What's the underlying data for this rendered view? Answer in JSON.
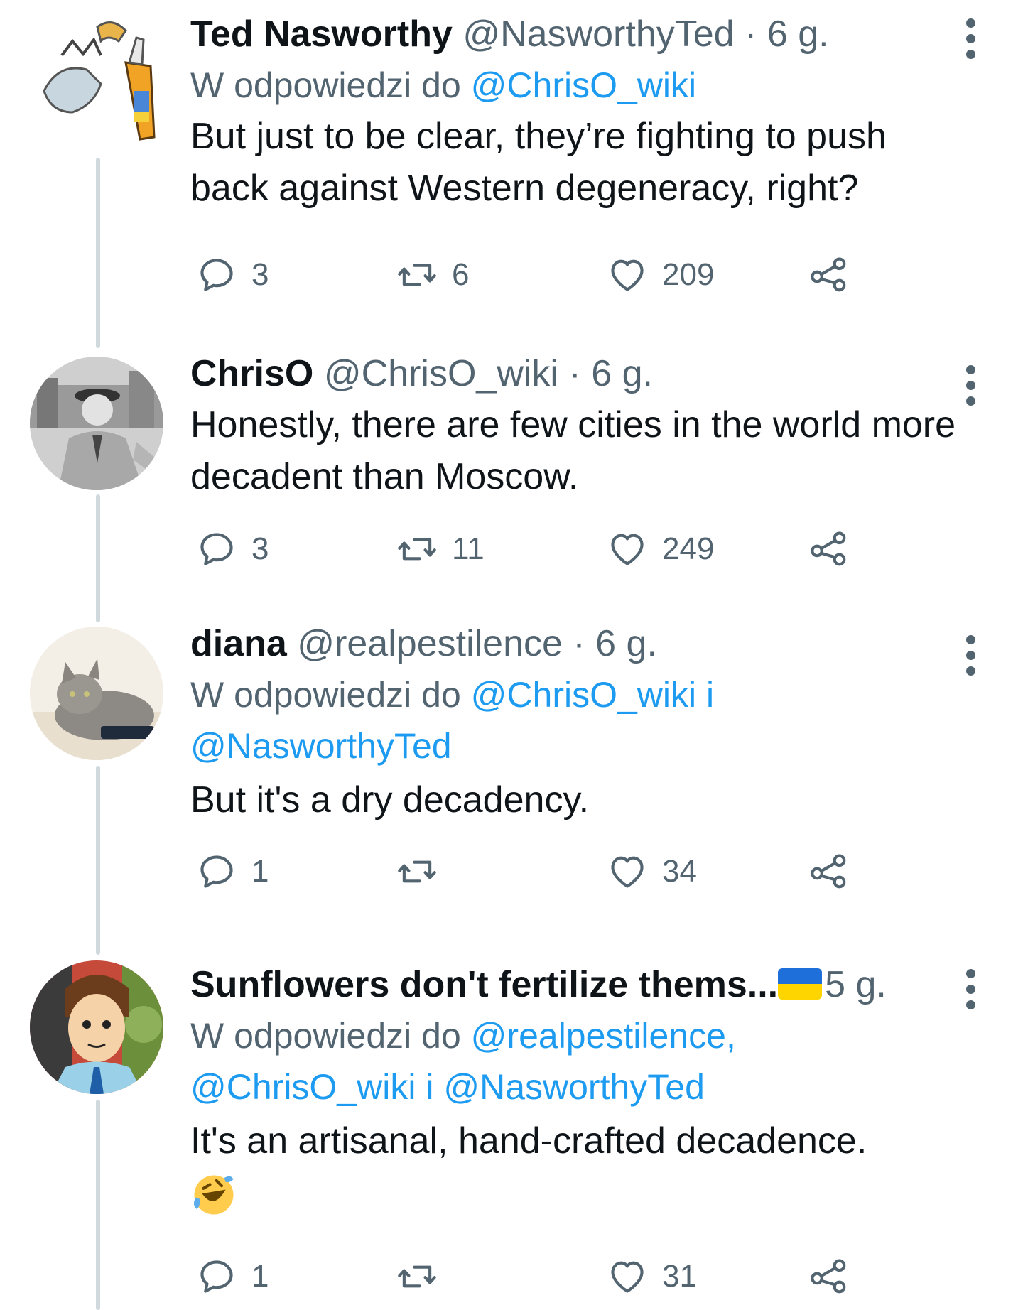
{
  "tweets": [
    {
      "name": "Ted Nasworthy",
      "handle": "@NasworthyTed",
      "sep": "·",
      "time": "6 g.",
      "reply_prefix": "W odpowiedzi do",
      "reply_mentions_line1": "@ChrisO_wiki",
      "reply_mentions_line2": "",
      "text": "But just to be clear, they’re fighting to push back against Western degeneracy, right?",
      "replies": "3",
      "retweets": "6",
      "likes": "209"
    },
    {
      "name": "ChrisO",
      "handle": "@ChrisO_wiki",
      "sep": "·",
      "time": "6 g.",
      "text": "Honestly, there are few cities in the world more decadent than Moscow.",
      "replies": "3",
      "retweets": "11",
      "likes": "249"
    },
    {
      "name": "diana",
      "handle": "@realpestilence",
      "sep": "·",
      "time": "6 g.",
      "reply_prefix": "W odpowiedzi do",
      "reply_mentions_line1": "@ChrisO_wiki i",
      "reply_mentions_line2": "@NasworthyTed",
      "text": "But it's a dry decadency.",
      "replies": "1",
      "retweets": "",
      "likes": "34"
    },
    {
      "name": "Sunflowers don't fertilize thems...",
      "handle": "",
      "sep": "",
      "time": "5 g.",
      "reply_prefix": "W odpowiedzi do",
      "reply_mentions_line1": "@realpestilence,",
      "reply_mentions_line2": "@ChrisO_wiki i @NasworthyTed",
      "text": "It's an artisanal, hand-crafted decadence.",
      "replies": "1",
      "retweets": "",
      "likes": "31"
    }
  ],
  "icons": {
    "reply": "reply-icon",
    "retweet": "retweet-icon",
    "like": "heart-icon",
    "share": "share-icon",
    "more": "more-options-icon",
    "flag": "ukraine-flag-icon",
    "emoji": "rolling-on-floor-laughing-emoji"
  },
  "colors": {
    "link": "#1d9bf0",
    "secondary": "#536471",
    "thread_line": "#cfd9de"
  }
}
